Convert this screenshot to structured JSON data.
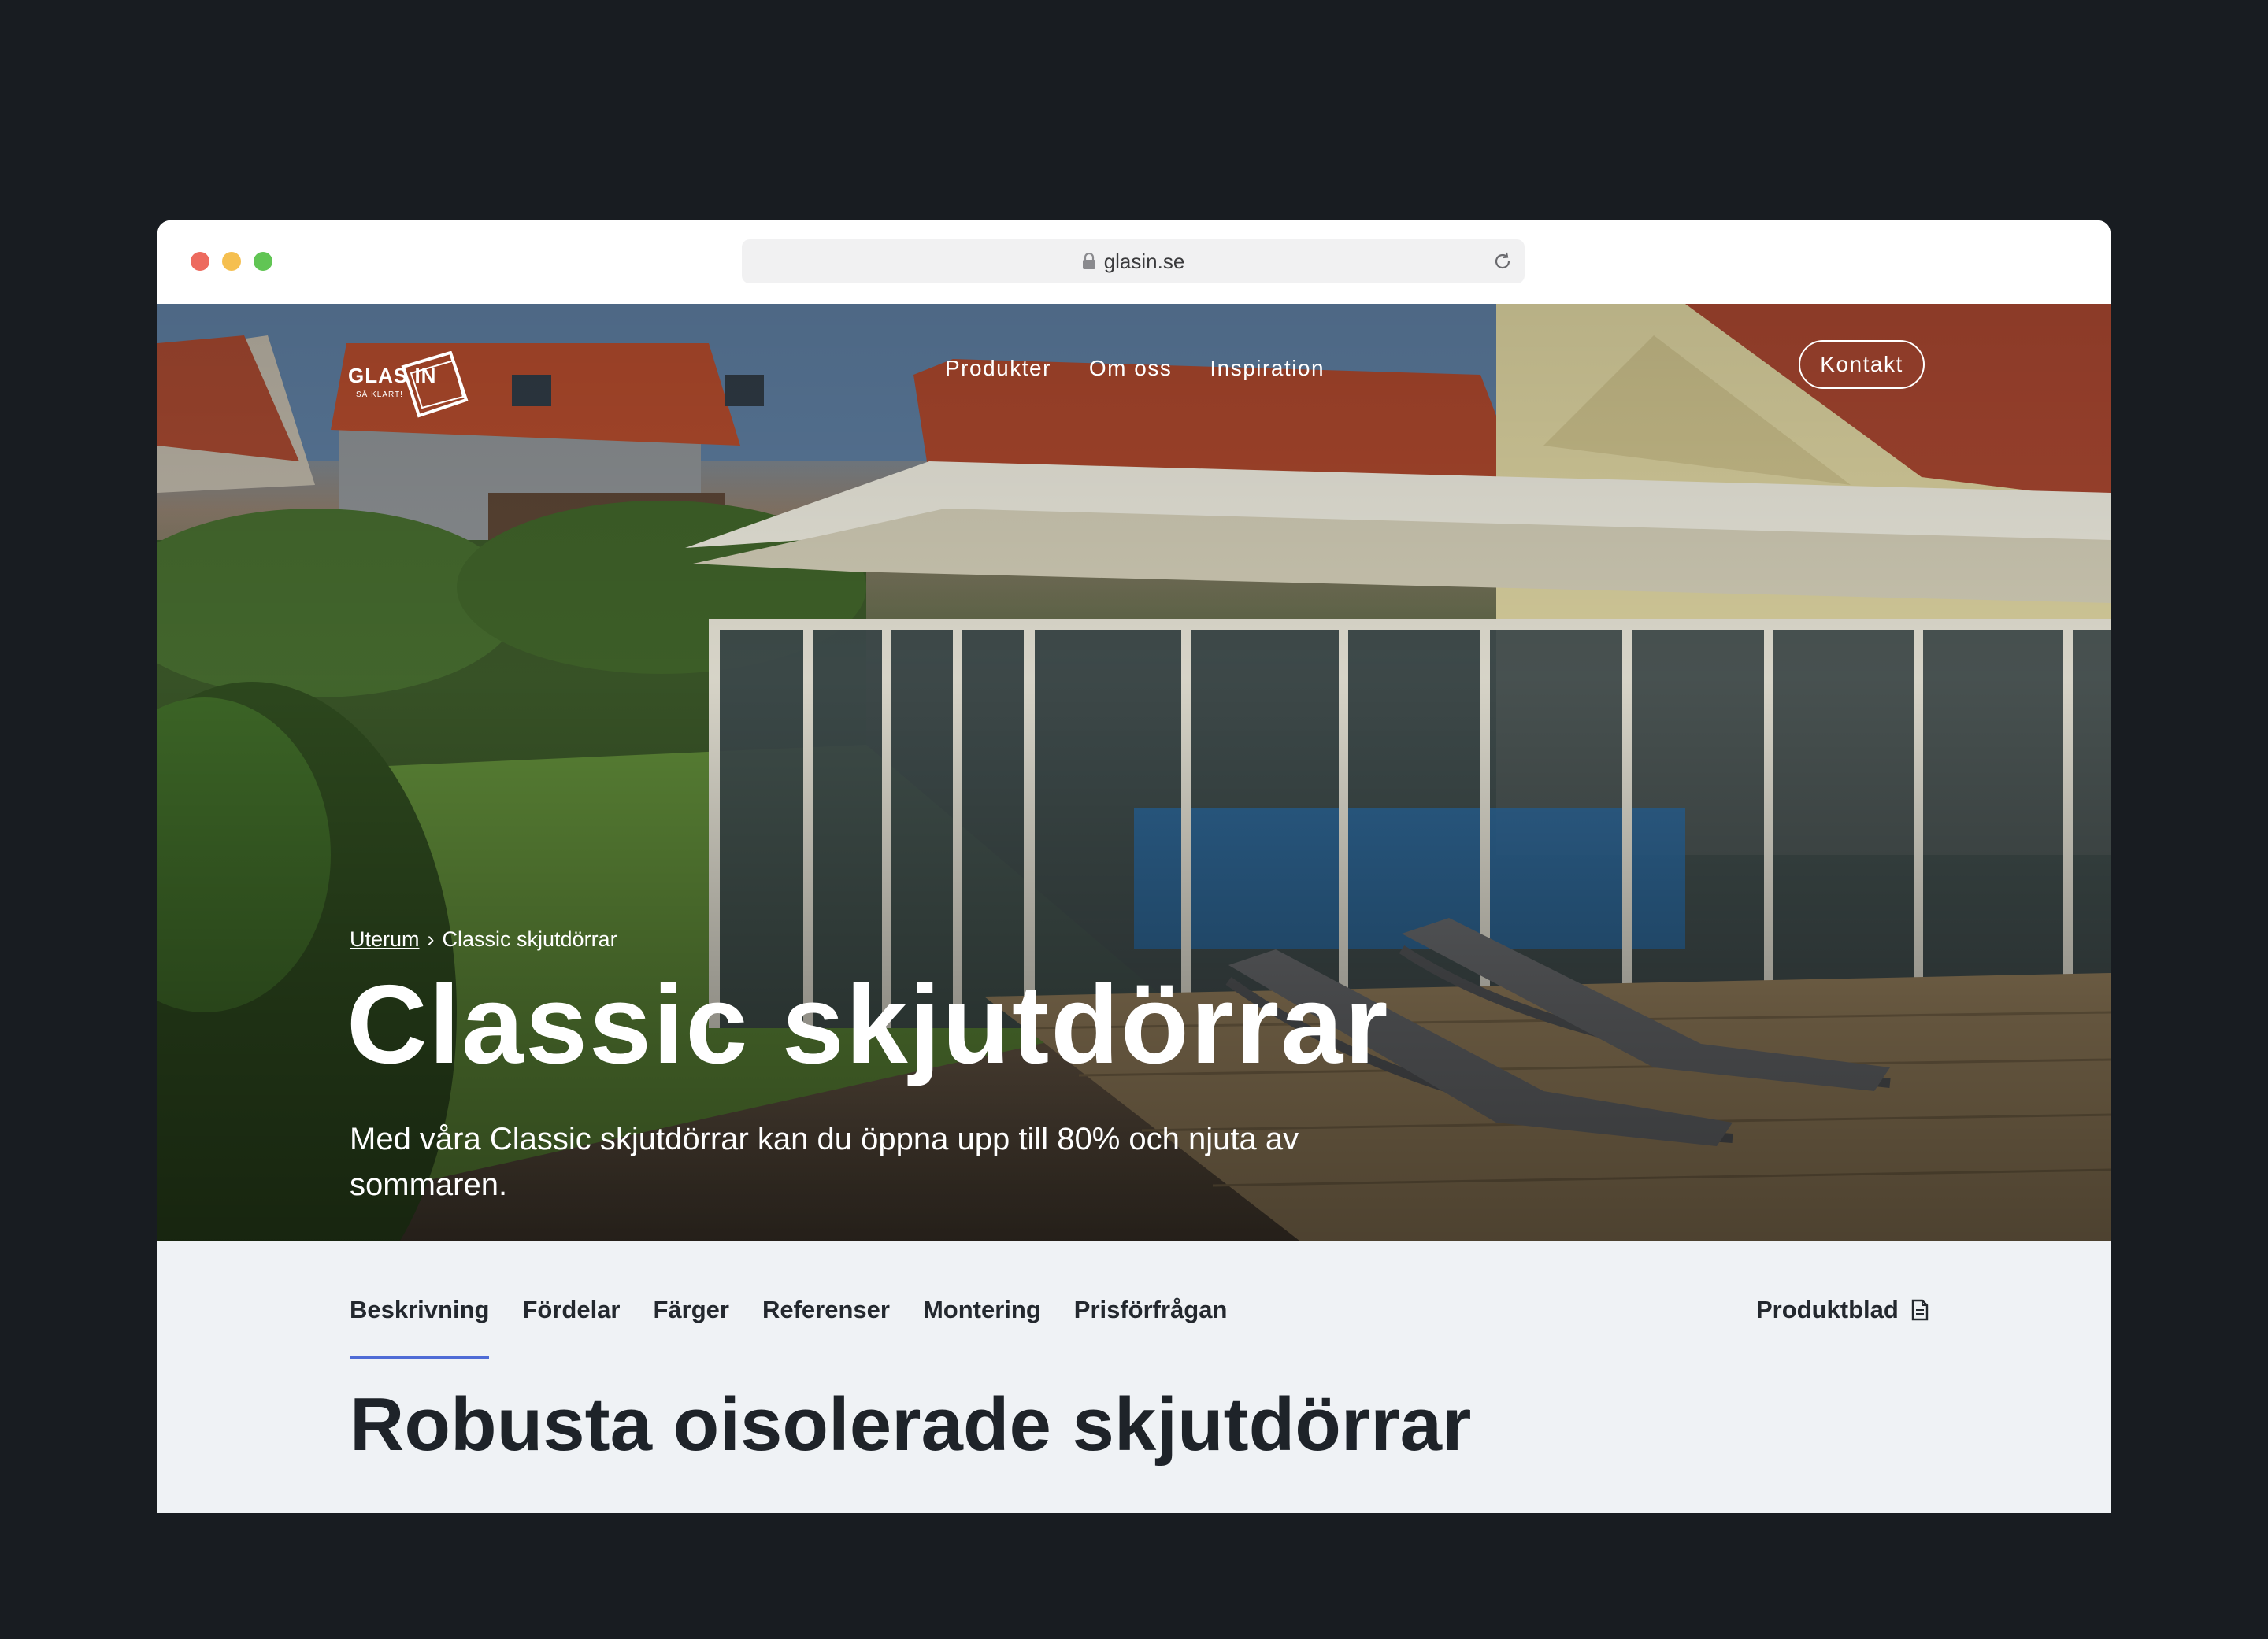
{
  "browser": {
    "url": "glasin.se"
  },
  "header": {
    "logo_text": "GLAS IN",
    "logo_sub": "SÅ KLART!",
    "nav": [
      "Produkter",
      "Om oss",
      "Inspiration"
    ],
    "cta_label": "Kontakt"
  },
  "hero": {
    "breadcrumb_parent": "Uterum",
    "breadcrumb_separator": "›",
    "breadcrumb_current": "Classic skjutdörrar",
    "title": "Classic skjutdörrar",
    "subtitle": "Med våra Classic skjutdörrar kan du öppna upp till 80%  och njuta av sommaren."
  },
  "tabs": {
    "items": [
      "Beskrivning",
      "Fördelar",
      "Färger",
      "Referenser",
      "Montering",
      "Prisförfrågan"
    ],
    "active": "Beskrivning",
    "produktblad_label": "Produktblad"
  },
  "section": {
    "title": "Robusta oisolerade skjutdörrar"
  },
  "colors": {
    "page_bg": "#181c21",
    "content_bg": "#eff2f5",
    "accent": "#4f6cd6",
    "text_dark": "#23282e"
  }
}
